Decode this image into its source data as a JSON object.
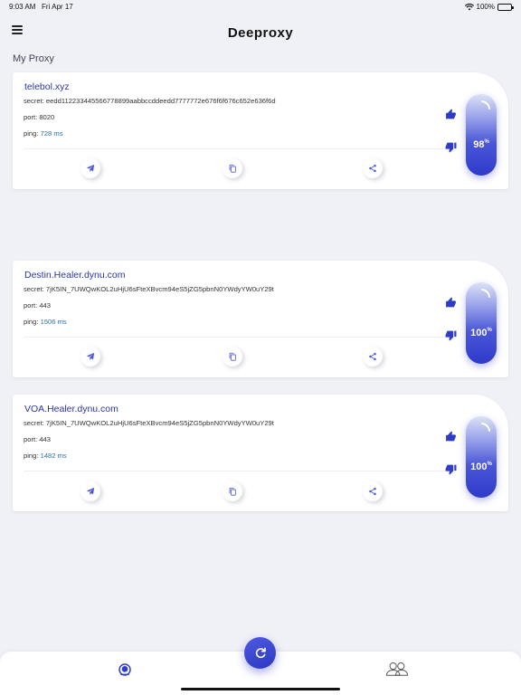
{
  "status_bar": {
    "time": "9:03 AM",
    "date": "Fri Apr 17",
    "battery": "100%"
  },
  "header": {
    "title": "Deeproxy",
    "menu_icon": "hamburger-icon"
  },
  "section": {
    "title": "My Proxy"
  },
  "proxies": [
    {
      "host": "telebol.xyz",
      "secret_label": "secret:",
      "secret": "eedd112233445566778899aabbccddeedd7777772e676f6f676c652e636f6d",
      "port_label": "port:",
      "port": "8020",
      "ping_label": "ping:",
      "ping": "728 ms",
      "score": "98",
      "score_unit": "%"
    },
    {
      "host": "Destin.Healer.dynu.com",
      "secret_label": "secret:",
      "secret": "7jK5IN_7UWQwKOL2uHjU6sFteXBvcm94eS5jZG5pbnN0YWdyYW0uY29t",
      "port_label": "port:",
      "port": "443",
      "ping_label": "ping:",
      "ping": "1506 ms",
      "score": "100",
      "score_unit": "%"
    },
    {
      "host": "VOA.Healer.dynu.com",
      "secret_label": "secret:",
      "secret": "7jK5IN_7UWQwKOL2uHjU6sFteXBvcm94eS5jZG5pbnN0YWdyYW0uY29t",
      "port_label": "port:",
      "port": "443",
      "ping_label": "ping:",
      "ping": "1482 ms",
      "score": "100",
      "score_unit": "%"
    }
  ],
  "card_actions": [
    "telegram-icon",
    "copy-icon",
    "share-icon"
  ],
  "tab_bar": {
    "tabs": [
      "proxy-tab-icon",
      "friends-tab-icon"
    ],
    "refresh_icon": "refresh-icon"
  },
  "colors": {
    "accent": "#2f3bc9",
    "link": "#2b35a8",
    "ping": "#2b6fa6",
    "background": "#f0f1f6"
  }
}
